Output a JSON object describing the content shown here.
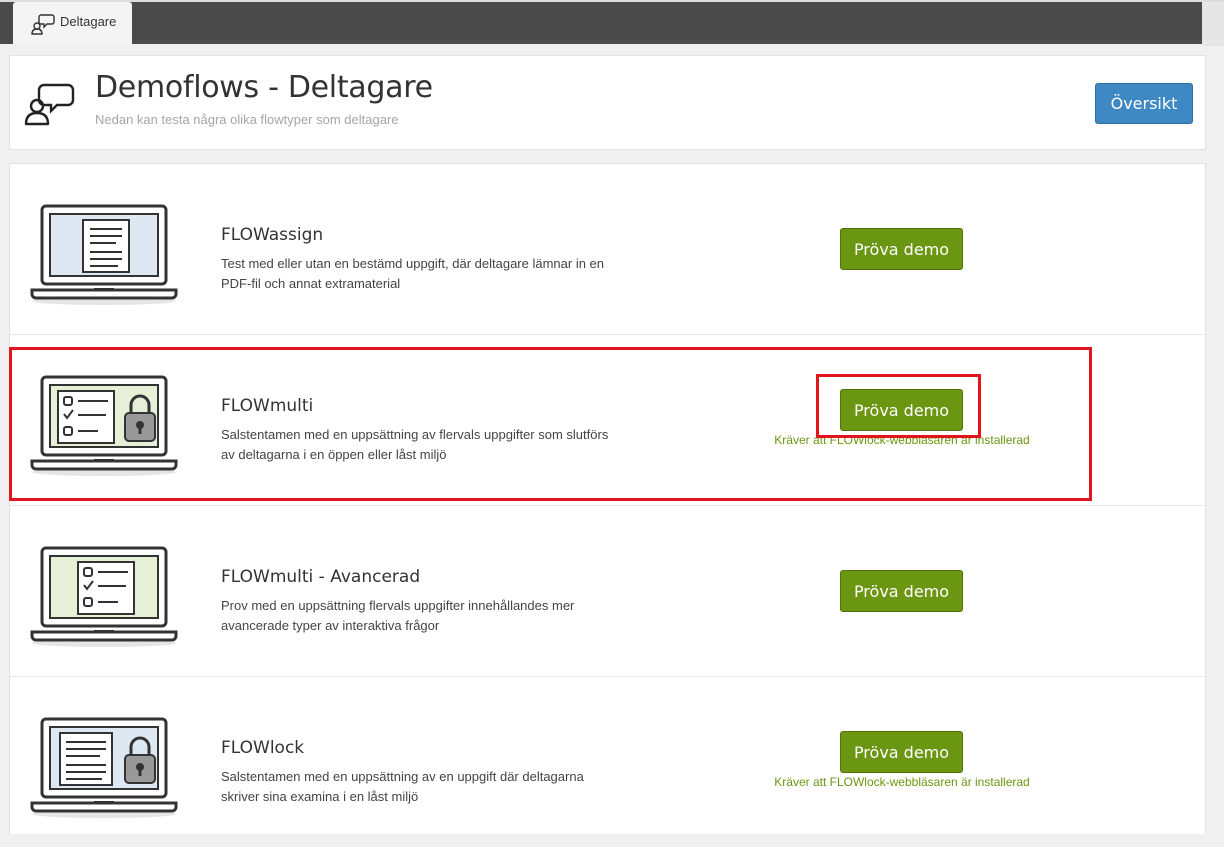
{
  "tab": {
    "label": "Deltagare",
    "icon": "chat-user-icon"
  },
  "header": {
    "title": "Demoflows - Deltagare",
    "subtitle": "Nedan kan testa några olika flowtyper som deltagare",
    "overview_button": "Översikt",
    "icon": "chat-user-icon"
  },
  "colors": {
    "green_button": "#6b9612",
    "blue_button": "#3e88c3",
    "highlight": "#e3141e"
  },
  "flows": [
    {
      "title": "FLOWassign",
      "description": "Test med eller utan en bestämd uppgift, där deltagare lämnar in en PDF-fil och annat extramaterial",
      "button": "Pröva demo",
      "note": "",
      "icon": "laptop-document-icon"
    },
    {
      "title": "FLOWmulti",
      "description": "Salstentamen med en uppsättning av flervals uppgifter som slutförs av deltagarna i en öppen eller låst miljö",
      "button": "Pröva demo",
      "note": "Kräver att FLOWlock-webbläsaren är installerad",
      "icon": "laptop-checklist-lock-icon"
    },
    {
      "title": "FLOWmulti - Avancerad",
      "description": "Prov med en uppsättning flervals uppgifter innehållandes mer avancerade typer av interaktiva frågor",
      "button": "Pröva demo",
      "note": "",
      "icon": "laptop-checklist-icon"
    },
    {
      "title": "FLOWlock",
      "description": "Salstentamen med en uppsättning av en uppgift där deltagarna skriver sina examina i en låst miljö",
      "button": "Pröva demo",
      "note": "Kräver att FLOWlock-webbläsaren är installerad",
      "icon": "laptop-document-lock-icon"
    }
  ]
}
